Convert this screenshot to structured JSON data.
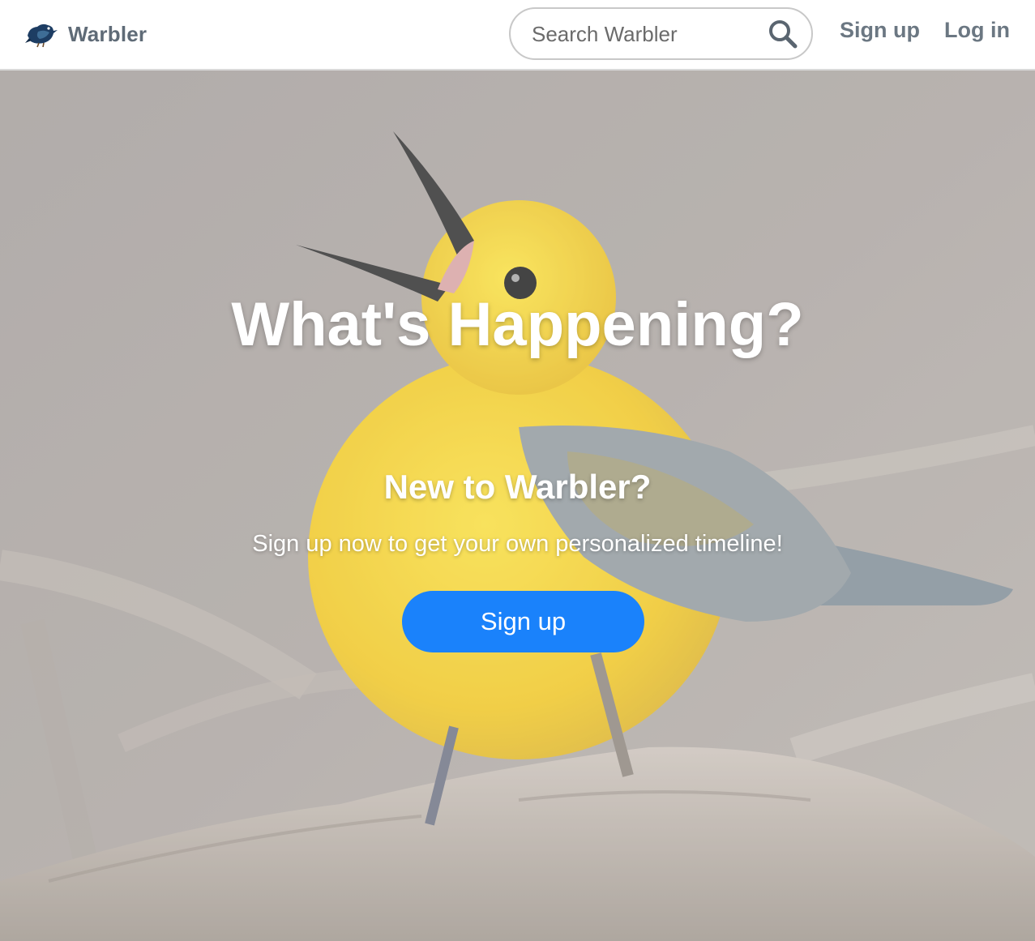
{
  "navbar": {
    "brand_name": "Warbler",
    "search": {
      "placeholder": "Search Warbler"
    },
    "signup_label": "Sign up",
    "login_label": "Log in"
  },
  "hero": {
    "title": "What's Happening?",
    "subtitle": "New to Warbler?",
    "text": "Sign up now to get your own personalized timeline!",
    "signup_button": "Sign up"
  },
  "colors": {
    "primary_button": "#1a82fb",
    "nav_text": "#6b7782",
    "bird_yellow": "#f2cf2a",
    "background_gray": "#aaa39d"
  }
}
